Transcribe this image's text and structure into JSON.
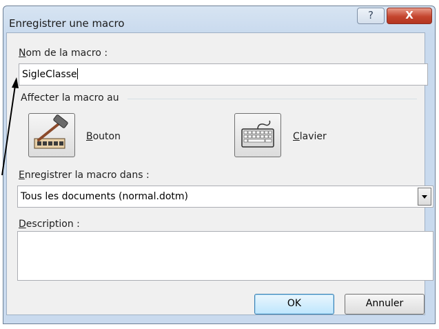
{
  "window": {
    "title": "Enregistrer une macro",
    "help_glyph": "?",
    "close_glyph": "X"
  },
  "macro_name": {
    "label_accel": "N",
    "label_rest": "om de la macro :",
    "value": "SigleClasse"
  },
  "assign": {
    "group_label": "Affecter la macro au",
    "button_label_accel": "B",
    "button_label_rest": "outon",
    "keyboard_label_accel": "C",
    "keyboard_label_rest": "lavier",
    "button_icon": "hammer-toolbar-icon",
    "keyboard_icon": "keyboard-icon"
  },
  "store_in": {
    "label_accel": "E",
    "label_rest": "nregistrer la macro dans :",
    "selected": "Tous les documents (normal.dotm)"
  },
  "description": {
    "label_accel": "D",
    "label_rest": "escription :",
    "value": ""
  },
  "actions": {
    "ok_label": "OK",
    "cancel_label": "Annuler"
  },
  "colors": {
    "title_gradient_top": "#d7e4f2",
    "close_button": "#c4452e",
    "ok_button_border": "#3c7fb1"
  }
}
